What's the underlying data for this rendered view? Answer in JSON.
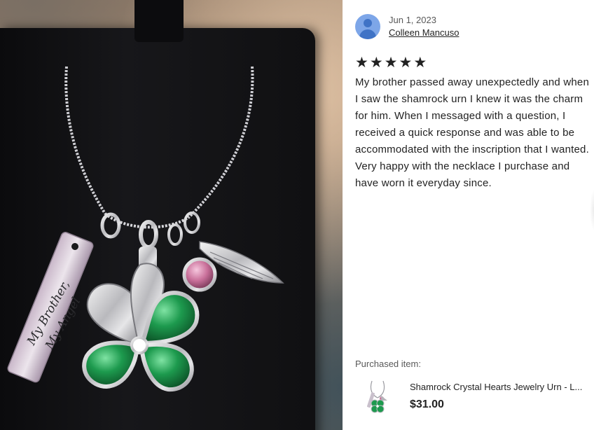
{
  "photo": {
    "alt": "Silver necklace with shamrock urn charm, angel wing charm, pink crystal and engraved bar charm on black display",
    "engraving_line1": "My Brother,",
    "engraving_line2": "My Angel"
  },
  "review": {
    "date": "Jun 1, 2023",
    "reviewer": "Colleen Mancuso",
    "rating": 5,
    "stars": [
      "★",
      "★",
      "★",
      "★",
      "★"
    ],
    "text": "My brother passed away unexpectedly and when I saw the shamrock urn I knew it was the charm for him. When I messaged with a question, I received a quick response and was able to be accommodated with the inscription that I wanted. Very happy with the necklace I purchase and have worn it everyday since."
  },
  "purchased": {
    "label": "Purchased item:",
    "title": "Shamrock Crystal Hearts Jewelry Urn - L...",
    "price": "$31.00"
  },
  "colors": {
    "avatar_bg": "#7da6e8",
    "avatar_fg": "#3f73c6",
    "text": "#222222",
    "muted": "#595959",
    "emerald": "#1d9a4e",
    "pink_crystal": "#c9709a"
  }
}
